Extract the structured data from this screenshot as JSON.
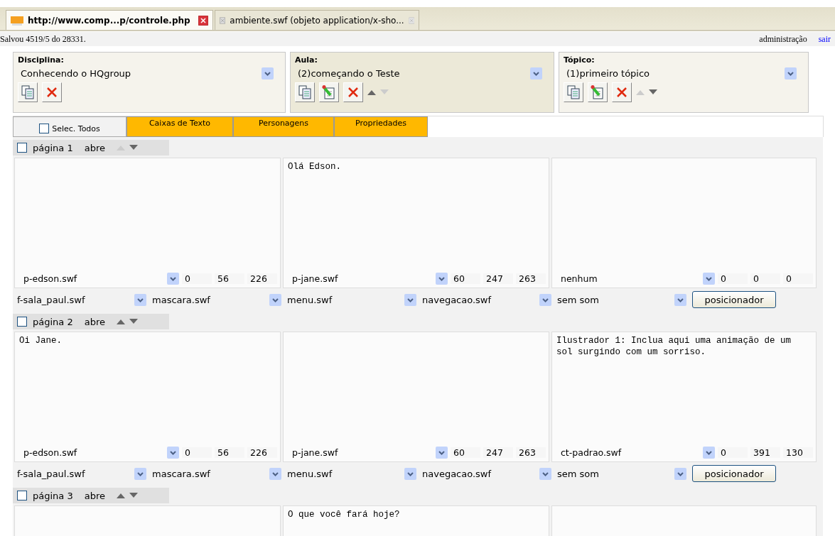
{
  "browser_tabs": [
    {
      "title": "http://www.comp...p/controle.php",
      "selected": true
    },
    {
      "title": "ambiente.swf (objeto application/x-sho...",
      "selected": false
    }
  ],
  "status": {
    "message": "Salvou 4519/5 do 28331.",
    "user": "administração",
    "logout": "sair"
  },
  "selectors": [
    {
      "label": "Disciplina:",
      "value": "Conhecendo o HQgroup",
      "highlighted": false,
      "actions": [
        {
          "kind": "copy"
        },
        {
          "kind": "delete"
        }
      ]
    },
    {
      "label": "Aula:",
      "value": "(2)começando o Teste",
      "highlighted": true,
      "actions": [
        {
          "kind": "copy"
        },
        {
          "kind": "edit"
        },
        {
          "kind": "delete"
        }
      ],
      "up_enabled": true,
      "down_enabled": false
    },
    {
      "label": "Tópico:",
      "value": "(1)primeiro tópico",
      "highlighted": false,
      "actions": [
        {
          "kind": "copy"
        },
        {
          "kind": "edit"
        },
        {
          "kind": "delete"
        }
      ],
      "up_enabled": false,
      "down_enabled": true
    }
  ],
  "toolbar": [
    {
      "kind": "checkbox",
      "label": "Selec. Todos",
      "checked": false
    },
    {
      "kind": "tab",
      "label": "Caixas de Texto"
    },
    {
      "kind": "tab",
      "label": "Personagens"
    },
    {
      "kind": "tab",
      "label": "Propriedades"
    }
  ],
  "pages": [
    {
      "label": "página 1",
      "open": "abre",
      "checked": false,
      "up_enabled": false,
      "down_enabled": true,
      "cells": [
        {
          "file": "p-edson.swf",
          "values": [
            "0",
            "56",
            "226"
          ]
        },
        {
          "text": "Olá Edson.",
          "file": "p-jane.swf",
          "values": [
            "60",
            "247",
            "263"
          ]
        },
        {
          "file": "nenhum",
          "values": [
            "0",
            "0",
            "0"
          ]
        }
      ],
      "assets": [
        "f-sala_paul.swf",
        "mascara.swf",
        "menu.swf",
        "navegacao.swf",
        "sem som"
      ],
      "action": "posicionador"
    },
    {
      "label": "página 2",
      "open": "abre",
      "checked": false,
      "up_enabled": true,
      "down_enabled": true,
      "cells": [
        {
          "text": "Oi Jane.",
          "file": "p-edson.swf",
          "values": [
            "0",
            "56",
            "226"
          ]
        },
        {
          "file": "p-jane.swf",
          "values": [
            "60",
            "247",
            "263"
          ]
        },
        {
          "text": "Ilustrador 1: Inclua aqui uma animação de um sol surgindo com um sorriso.",
          "file": "ct-padrao.swf",
          "values": [
            "0",
            "391",
            "130"
          ]
        }
      ],
      "assets": [
        "f-sala_paul.swf",
        "mascara.swf",
        "menu.swf",
        "navegacao.swf",
        "sem som"
      ],
      "action": "posicionador"
    },
    {
      "label": "página 3",
      "open": "abre",
      "checked": false,
      "up_enabled": true,
      "down_enabled": true,
      "cells": [
        {},
        {
          "text": "O que você fará hoje?"
        },
        {}
      ]
    }
  ]
}
